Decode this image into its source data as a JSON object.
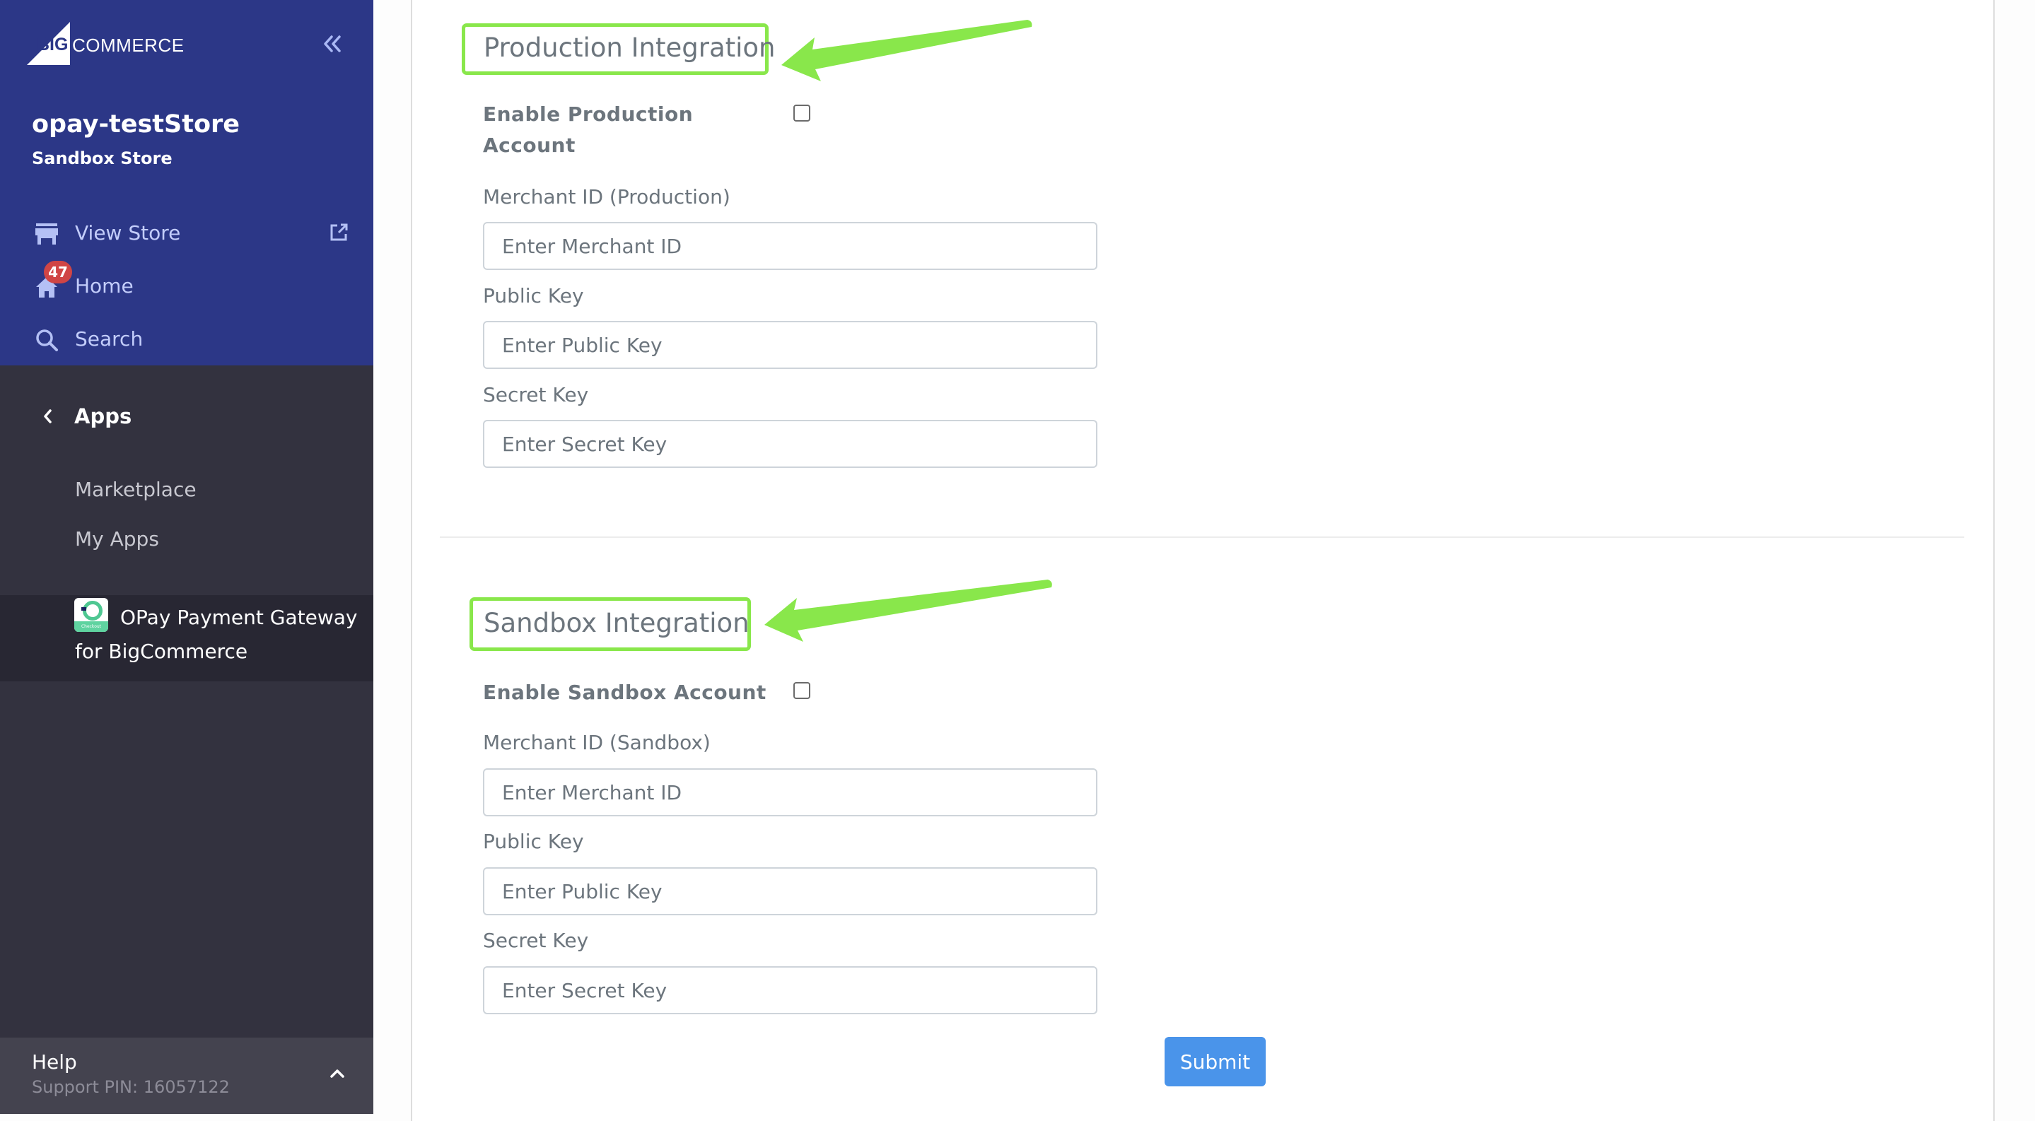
{
  "sidebar": {
    "brand": {
      "big": "BIG",
      "commerce": "COMMERCE"
    },
    "collapse_icon": "double-chevron-left-icon",
    "store_name": "opay-testStore",
    "store_type": "Sandbox Store",
    "nav": [
      {
        "label": "View Store",
        "icon": "storefront-icon",
        "trailing_icon": "external-link-icon"
      },
      {
        "label": "Home",
        "icon": "home-icon",
        "badge": "47"
      },
      {
        "label": "Search",
        "icon": "search-icon"
      }
    ],
    "section": {
      "label": "Apps",
      "icon": "chevron-left-icon"
    },
    "sub_items": [
      "Marketplace",
      "My Apps"
    ],
    "active_app": {
      "label": "OPay Payment Gateway for BigCommerce",
      "icon_text": "Checkout"
    },
    "help": {
      "title": "Help",
      "support_pin": "Support PIN: 16057122",
      "icon": "chevron-up-icon"
    }
  },
  "main": {
    "production": {
      "title": "Production Integration",
      "enable_label": "Enable Production Account",
      "enabled": false,
      "fields": [
        {
          "label": "Merchant ID (Production)",
          "placeholder": "Enter Merchant ID",
          "value": ""
        },
        {
          "label": "Public Key",
          "placeholder": "Enter Public Key",
          "value": ""
        },
        {
          "label": "Secret Key",
          "placeholder": "Enter Secret Key",
          "value": ""
        }
      ]
    },
    "sandbox": {
      "title": "Sandbox Integration",
      "enable_label": "Enable Sandbox Account",
      "enabled": false,
      "fields": [
        {
          "label": "Merchant ID (Sandbox)",
          "placeholder": "Enter Merchant ID",
          "value": ""
        },
        {
          "label": "Public Key",
          "placeholder": "Enter Public Key",
          "value": ""
        },
        {
          "label": "Secret Key",
          "placeholder": "Enter Secret Key",
          "value": ""
        }
      ]
    },
    "submit_label": "Submit"
  },
  "annotations": {
    "highlight_color": "#89e74b",
    "arrows": [
      "arrow-to-production-title",
      "arrow-to-sandbox-title"
    ]
  },
  "colors": {
    "sidebar_brand_bg": "#2c3787",
    "sidebar_dark_bg": "#33323f",
    "badge": "#d04545",
    "submit": "#4a94ea"
  }
}
